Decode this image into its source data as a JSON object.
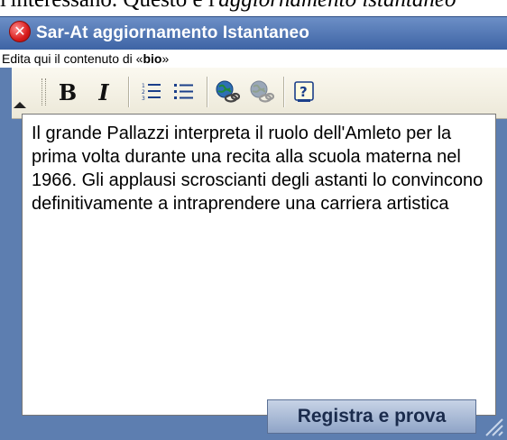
{
  "background_text": {
    "normal": "l'interessano. Questo è l'",
    "italic": "aggiornamento istantaneo"
  },
  "window": {
    "title": "Sar-At aggiornamento Istantaneo",
    "close_glyph": "✕"
  },
  "infobar": {
    "prefix": "Edita qui il contenuto di «",
    "field": "bio",
    "suffix": "»"
  },
  "toolbar": {
    "bold_label": "B",
    "italic_label": "I",
    "ordered_list_icon": "ordered-list-icon",
    "unordered_list_icon": "unordered-list-icon",
    "link_icon": "insert-link-icon",
    "unlink_icon": "remove-link-icon",
    "help_icon": "help-icon",
    "help_glyph": "?"
  },
  "editor": {
    "content": "Il grande Pallazzi interpreta il ruolo dell'Amleto per la prima volta durante una recita alla scuola materna nel 1966. Gli applausi scroscianti degli astanti lo convincono definitivamente a intraprendere una carriera artistica"
  },
  "footer": {
    "save_label": "Registra e prova"
  },
  "colors": {
    "window_bg": "#5d7eb0",
    "title_bar": "#3e64a5",
    "toolbar_bg": "#ece8d8",
    "button_bg": "#a9bad6"
  }
}
